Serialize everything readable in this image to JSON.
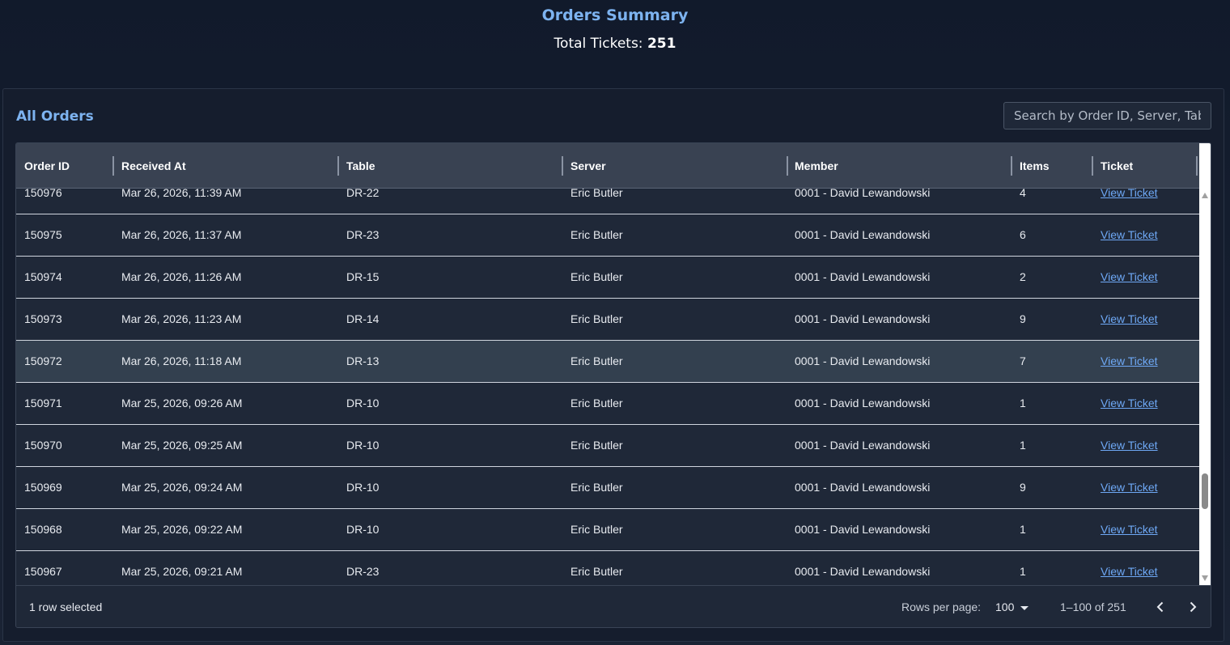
{
  "header": {
    "title": "Orders Summary",
    "total_label": "Total Tickets:",
    "total_value": "251"
  },
  "panel": {
    "title": "All Orders",
    "search_placeholder": "Search by Order ID, Server, Table"
  },
  "table": {
    "columns": [
      "Order ID",
      "Received At",
      "Table",
      "Server",
      "Member",
      "Items",
      "Ticket"
    ],
    "rows": [
      {
        "order_id": "150976",
        "received_at": "Mar 26, 2026, 11:39 AM",
        "table": "DR-22",
        "server": "Eric Butler",
        "member": "0001 - David Lewandowski",
        "items": "4",
        "ticket": "View Ticket"
      },
      {
        "order_id": "150975",
        "received_at": "Mar 26, 2026, 11:37 AM",
        "table": "DR-23",
        "server": "Eric Butler",
        "member": "0001 - David Lewandowski",
        "items": "6",
        "ticket": "View Ticket"
      },
      {
        "order_id": "150974",
        "received_at": "Mar 26, 2026, 11:26 AM",
        "table": "DR-15",
        "server": "Eric Butler",
        "member": "0001 - David Lewandowski",
        "items": "2",
        "ticket": "View Ticket"
      },
      {
        "order_id": "150973",
        "received_at": "Mar 26, 2026, 11:23 AM",
        "table": "DR-14",
        "server": "Eric Butler",
        "member": "0001 - David Lewandowski",
        "items": "9",
        "ticket": "View Ticket"
      },
      {
        "order_id": "150972",
        "received_at": "Mar 26, 2026, 11:18 AM",
        "table": "DR-13",
        "server": "Eric Butler",
        "member": "0001 - David Lewandowski",
        "items": "7",
        "ticket": "View Ticket",
        "selected": true
      },
      {
        "order_id": "150971",
        "received_at": "Mar 25, 2026, 09:26 AM",
        "table": "DR-10",
        "server": "Eric Butler",
        "member": "0001 - David Lewandowski",
        "items": "1",
        "ticket": "View Ticket"
      },
      {
        "order_id": "150970",
        "received_at": "Mar 25, 2026, 09:25 AM",
        "table": "DR-10",
        "server": "Eric Butler",
        "member": "0001 - David Lewandowski",
        "items": "1",
        "ticket": "View Ticket"
      },
      {
        "order_id": "150969",
        "received_at": "Mar 25, 2026, 09:24 AM",
        "table": "DR-10",
        "server": "Eric Butler",
        "member": "0001 - David Lewandowski",
        "items": "9",
        "ticket": "View Ticket"
      },
      {
        "order_id": "150968",
        "received_at": "Mar 25, 2026, 09:22 AM",
        "table": "DR-10",
        "server": "Eric Butler",
        "member": "0001 - David Lewandowski",
        "items": "1",
        "ticket": "View Ticket"
      },
      {
        "order_id": "150967",
        "received_at": "Mar 25, 2026, 09:21 AM",
        "table": "DR-23",
        "server": "Eric Butler",
        "member": "0001 - David Lewandowski",
        "items": "1",
        "ticket": "View Ticket"
      }
    ]
  },
  "footer": {
    "selection_text": "1 row selected",
    "rows_per_page_label": "Rows per page:",
    "rows_per_page_value": "100",
    "range_text": "1–100 of 251"
  },
  "icons": {
    "prev": "chevron-left-icon",
    "next": "chevron-right-icon",
    "dropdown": "caret-down-icon"
  },
  "colors": {
    "accent": "#7db3f0",
    "link": "#6ea8f5",
    "selected_row": "#33404f"
  }
}
